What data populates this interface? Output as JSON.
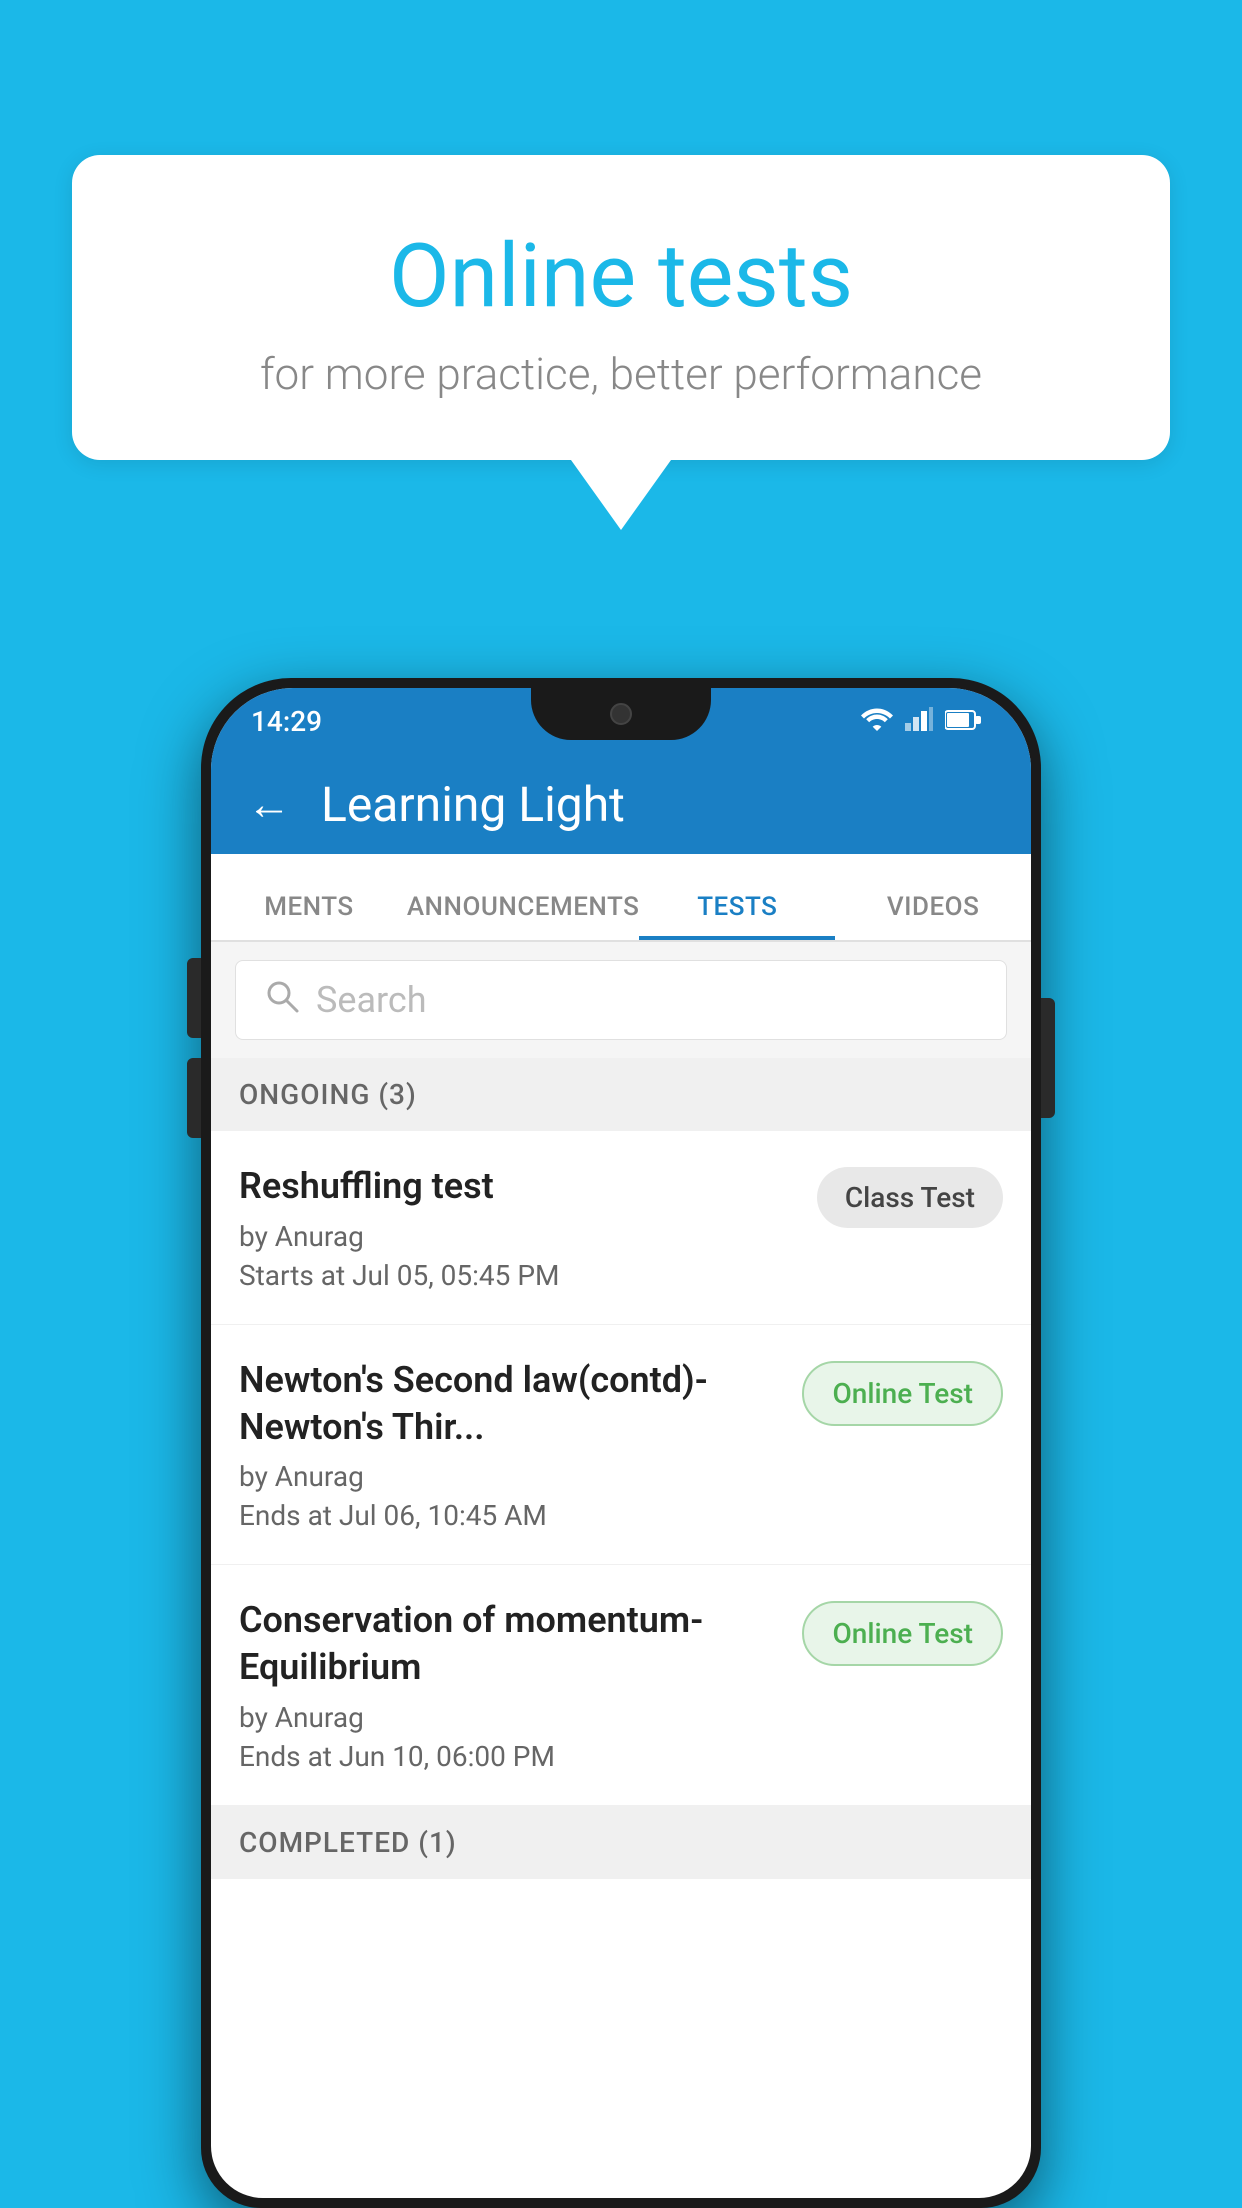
{
  "background": {
    "color": "#1BB8E8"
  },
  "speech_bubble": {
    "title": "Online tests",
    "subtitle": "for more practice, better performance"
  },
  "phone": {
    "status_bar": {
      "time": "14:29",
      "icons": [
        "wifi",
        "signal",
        "battery"
      ]
    },
    "app_bar": {
      "title": "Learning Light",
      "back_label": "←"
    },
    "tabs": [
      {
        "label": "MENTS",
        "active": false
      },
      {
        "label": "ANNOUNCEMENTS",
        "active": false
      },
      {
        "label": "TESTS",
        "active": true
      },
      {
        "label": "VIDEOS",
        "active": false
      }
    ],
    "search": {
      "placeholder": "Search"
    },
    "sections": [
      {
        "header": "ONGOING (3)",
        "items": [
          {
            "title": "Reshuffling test",
            "author": "by Anurag",
            "date": "Starts at  Jul 05, 05:45 PM",
            "badge": "Class Test",
            "badge_type": "class"
          },
          {
            "title": "Newton's Second law(contd)-Newton's Thir...",
            "author": "by Anurag",
            "date": "Ends at  Jul 06, 10:45 AM",
            "badge": "Online Test",
            "badge_type": "online"
          },
          {
            "title": "Conservation of momentum-Equilibrium",
            "author": "by Anurag",
            "date": "Ends at  Jun 10, 06:00 PM",
            "badge": "Online Test",
            "badge_type": "online"
          }
        ]
      }
    ],
    "completed_section": {
      "header": "COMPLETED (1)"
    }
  }
}
